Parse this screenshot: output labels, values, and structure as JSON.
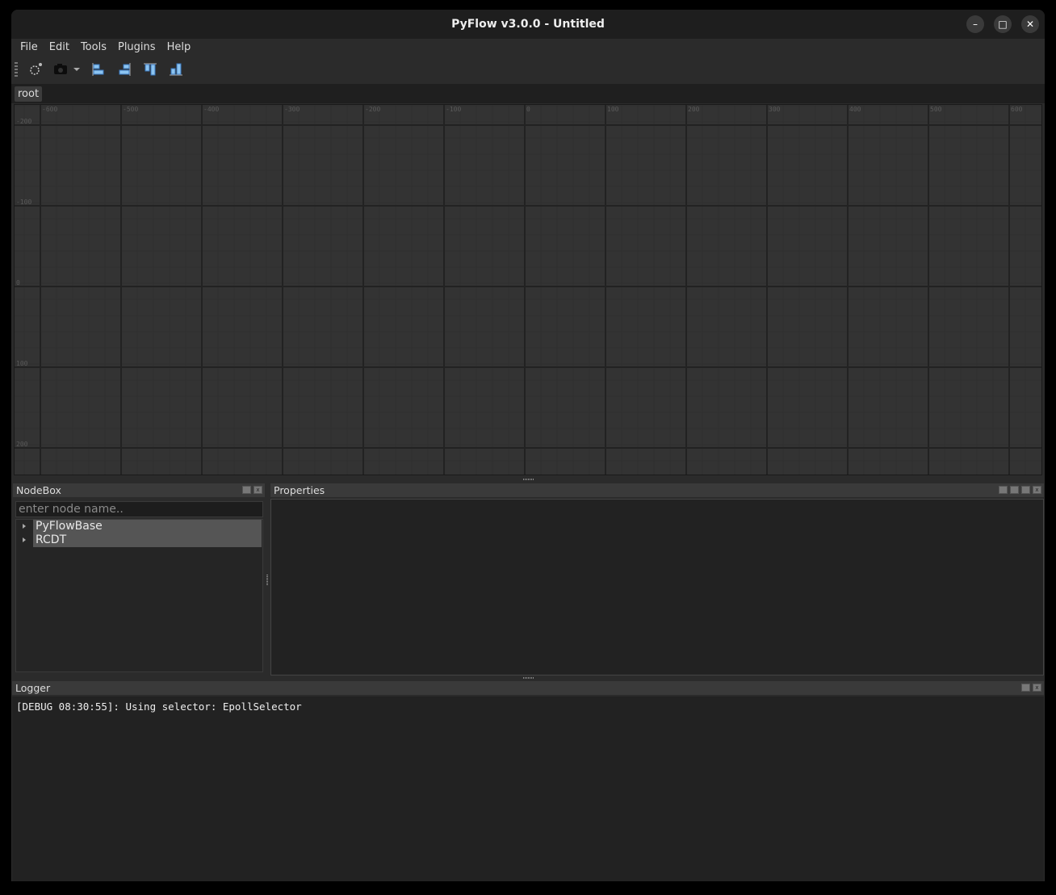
{
  "window": {
    "title": "PyFlow v3.0.0 - Untitled",
    "controls": [
      "minimize",
      "maximize",
      "close"
    ]
  },
  "menubar": {
    "items": [
      "File",
      "Edit",
      "Tools",
      "Plugins",
      "Help"
    ]
  },
  "toolbar": {
    "icons": [
      "settings-icon",
      "screenshot-icon",
      "align-left-icon",
      "align-right-icon",
      "align-top-icon",
      "align-bottom-icon"
    ],
    "accent": "#5aa0e0"
  },
  "tabs": {
    "root": "root"
  },
  "canvas": {
    "x_ticks": [
      "-600",
      "-500",
      "-400",
      "-300",
      "-200",
      "-100",
      "0",
      "100",
      "200",
      "300",
      "400",
      "500",
      "600"
    ],
    "y_ticks": [
      "-200",
      "-100",
      "0",
      "100",
      "200"
    ],
    "background": "#333333"
  },
  "nodebox": {
    "title": "NodeBox",
    "search_placeholder": "enter node name..",
    "items": [
      "PyFlowBase",
      "RCDT"
    ]
  },
  "properties": {
    "title": "Properties"
  },
  "logger": {
    "title": "Logger",
    "lines": [
      "[DEBUG 08:30:55]: Using selector: EpollSelector"
    ]
  }
}
